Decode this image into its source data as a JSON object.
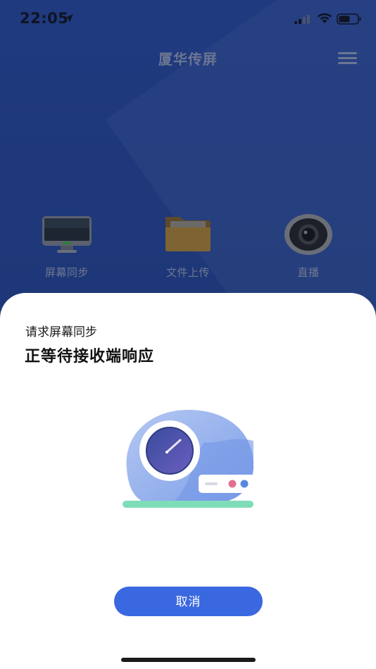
{
  "status_bar": {
    "time": "22:05",
    "location_icon": "location-arrow-icon",
    "signal_icon": "cellular-signal-icon",
    "wifi_icon": "wifi-icon",
    "battery_icon": "battery-icon"
  },
  "header": {
    "title": "厦华传屏",
    "menu_icon": "hamburger-menu-icon"
  },
  "features": [
    {
      "label": "屏幕同步",
      "icon": "monitor-icon"
    },
    {
      "label": "文件上传",
      "icon": "folder-icon"
    },
    {
      "label": "直播",
      "icon": "camera-icon"
    }
  ],
  "dialog": {
    "subtitle": "请求屏幕同步",
    "title": "正等待接收端响应",
    "illustration_icon": "waiting-device-illustration",
    "cancel_label": "取消"
  },
  "colors": {
    "background": "#1e3675",
    "accent": "#3a68e0",
    "sheet": "#ffffff"
  }
}
